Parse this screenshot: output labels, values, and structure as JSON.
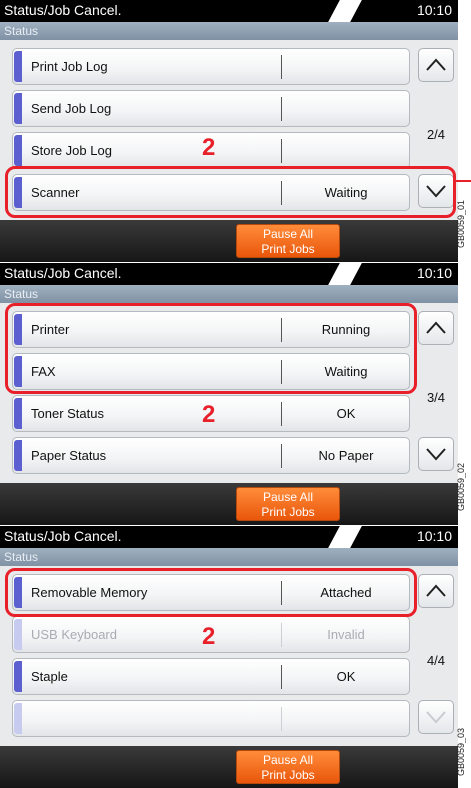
{
  "panels": [
    {
      "title": "Status/Job Cancel.",
      "clock": "10:10",
      "subtitle": "Status",
      "rows": [
        {
          "label": "Print Job Log",
          "value": "",
          "state": "normal"
        },
        {
          "label": "Send Job Log",
          "value": "",
          "state": "normal"
        },
        {
          "label": "Store Job Log",
          "value": "",
          "state": "normal"
        },
        {
          "label": "Scanner",
          "value": "Waiting",
          "state": "normal"
        }
      ],
      "page": "2/4",
      "down_enabled": true,
      "pause_label_1": "Pause All",
      "pause_label_2": "Print Jobs",
      "step": "2",
      "image_code": "GB0059_01"
    },
    {
      "title": "Status/Job Cancel.",
      "clock": "10:10",
      "subtitle": "Status",
      "rows": [
        {
          "label": "Printer",
          "value": "Running",
          "state": "normal"
        },
        {
          "label": "FAX",
          "value": "Waiting",
          "state": "normal"
        },
        {
          "label": "Toner Status",
          "value": "OK",
          "state": "normal"
        },
        {
          "label": "Paper Status",
          "value": "No Paper",
          "state": "normal"
        }
      ],
      "page": "3/4",
      "down_enabled": true,
      "pause_label_1": "Pause All",
      "pause_label_2": "Print Jobs",
      "step": "2",
      "image_code": "GB0059_02"
    },
    {
      "title": "Status/Job Cancel.",
      "clock": "10:10",
      "subtitle": "Status",
      "rows": [
        {
          "label": "Removable Memory",
          "value": "Attached",
          "state": "normal"
        },
        {
          "label": "USB Keyboard",
          "value": "Invalid",
          "state": "disabled"
        },
        {
          "label": "Staple",
          "value": "OK",
          "state": "normal"
        },
        {
          "label": "",
          "value": "",
          "state": "empty"
        }
      ],
      "page": "4/4",
      "down_enabled": false,
      "pause_label_1": "Pause All",
      "pause_label_2": "Print Jobs",
      "step": "2",
      "image_code": "GB0059_03"
    }
  ],
  "colors": {
    "highlight": "#e8202a",
    "row_tab": "#5c5fd0",
    "pause_button": "#f07020"
  },
  "icons": {
    "up": "chevron-up-icon",
    "down": "chevron-down-icon"
  }
}
